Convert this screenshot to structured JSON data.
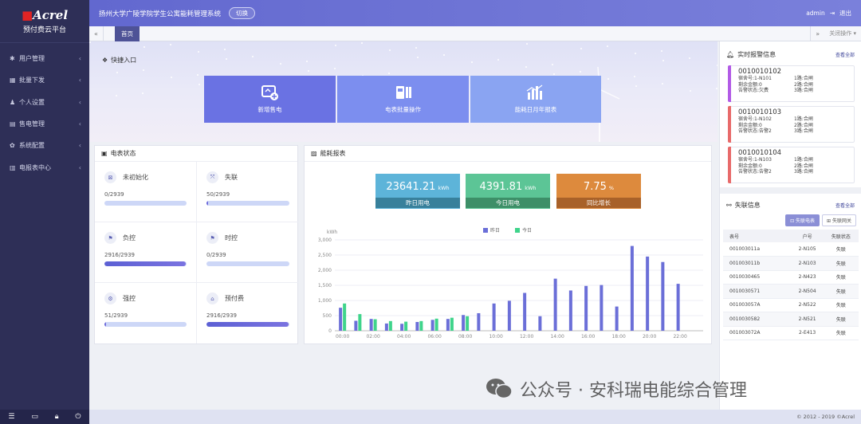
{
  "app": {
    "brand_prefix": "",
    "brand": "Acrel",
    "platform": "预付费云平台",
    "title": "扬州大学广陵学院学生公寓能耗管理系统",
    "switch_label": "切换",
    "user": "admin",
    "logout_label": "退出"
  },
  "menu": [
    {
      "icon": "✱",
      "label": "用户管理"
    },
    {
      "icon": "▦",
      "label": "批量下发"
    },
    {
      "icon": "♟",
      "label": "个人设置"
    },
    {
      "icon": "▤",
      "label": "售电管理"
    },
    {
      "icon": "✿",
      "label": "系统配置"
    },
    {
      "icon": "▥",
      "label": "电报表中心"
    }
  ],
  "tabs": {
    "active": "首页",
    "close_op": "关闭操作"
  },
  "quick": {
    "title": "快捷入口",
    "items": [
      {
        "label": "新增售电"
      },
      {
        "label": "电表批量操作"
      },
      {
        "label": "能耗日月年报表"
      }
    ]
  },
  "meter_status": {
    "title": "电表状态",
    "items": [
      {
        "label": "未初始化",
        "count": "0/2939",
        "fill": 0.0
      },
      {
        "label": "失联",
        "count": "50/2939",
        "fill": 0.017
      },
      {
        "label": "负控",
        "count": "2916/2939",
        "fill": 0.99
      },
      {
        "label": "时控",
        "count": "0/2939",
        "fill": 0.0
      },
      {
        "label": "强控",
        "count": "51/2939",
        "fill": 0.017
      },
      {
        "label": "预付费",
        "count": "2916/2939",
        "fill": 0.99
      }
    ]
  },
  "energy": {
    "title": "能耗报表",
    "yesterday": {
      "value": "23641.21",
      "unit": "kWh",
      "label": "昨日用电"
    },
    "today": {
      "value": "4391.81",
      "unit": "kWh",
      "label": "今日用电"
    },
    "growth": {
      "value": "7.75",
      "unit": "%",
      "label": "同比增长"
    }
  },
  "chart_data": {
    "type": "bar",
    "ylabel": "kWh",
    "ylim": [
      0,
      3000
    ],
    "yticks": [
      "0",
      "500",
      "1,000",
      "1,500",
      "2,000",
      "2,500",
      "3,000"
    ],
    "categories": [
      "00:00",
      "01:00",
      "02:00",
      "03:00",
      "04:00",
      "05:00",
      "06:00",
      "07:00",
      "08:00",
      "09:00",
      "10:00",
      "11:00",
      "12:00",
      "13:00",
      "14:00",
      "15:00",
      "16:00",
      "17:00",
      "18:00",
      "19:00",
      "20:00",
      "21:00",
      "22:00",
      "23:00"
    ],
    "xlabels": [
      "00:00",
      "02:00",
      "04:00",
      "06:00",
      "08:00",
      "10:00",
      "12:00",
      "14:00",
      "16:00",
      "18:00",
      "20:00",
      "22:00"
    ],
    "series": [
      {
        "name": "昨日",
        "color": "#6b6fd8",
        "values": [
          760,
          330,
          390,
          240,
          230,
          290,
          360,
          390,
          520,
          580,
          900,
          990,
          1250,
          480,
          1720,
          1330,
          1480,
          1510,
          800,
          2800,
          2450,
          2270,
          1550,
          0
        ]
      },
      {
        "name": "今日",
        "color": "#3fd48b",
        "values": [
          900,
          550,
          380,
          320,
          300,
          320,
          400,
          430,
          480,
          0,
          0,
          0,
          0,
          0,
          0,
          0,
          0,
          0,
          0,
          0,
          0,
          0,
          0,
          0
        ]
      }
    ]
  },
  "alarms": {
    "title": "实时报警信息",
    "more": "查看全部",
    "items": [
      {
        "id": "0010010102",
        "color": "#b25be6",
        "dorm": "宿舍号:1-N101",
        "amount": "剩余金额:0",
        "state": "告警状态:欠费",
        "r1": "1路:合闸",
        "r2": "2路:合闸",
        "r3": "3路:合闸"
      },
      {
        "id": "0010010103",
        "color": "#e86a6a",
        "dorm": "宿舍号:1-N102",
        "amount": "剩余金额:0",
        "state": "告警状态:告警2",
        "r1": "1路:合闸",
        "r2": "2路:合闸",
        "r3": "3路:合闸"
      },
      {
        "id": "0010010104",
        "color": "#e86a6a",
        "dorm": "宿舍号:1-N103",
        "amount": "剩余金额:0",
        "state": "告警状态:告警2",
        "r1": "1路:合闸",
        "r2": "2路:合闸",
        "r3": "3路:合闸"
      }
    ]
  },
  "lost": {
    "title": "失联信息",
    "more": "查看全部",
    "btn_meter": "失联电表",
    "btn_gateway": "失联网关",
    "headers": [
      "表号",
      "户号",
      "失联状态"
    ],
    "rows": [
      [
        "001003011a",
        "2-N105",
        "失联"
      ],
      [
        "001003011b",
        "2-N103",
        "失联"
      ],
      [
        "0010030465",
        "2-N423",
        "失联"
      ],
      [
        "0010030571",
        "2-N504",
        "失联"
      ],
      [
        "001003057A",
        "2-N522",
        "失联"
      ],
      [
        "0010030582",
        "2-N521",
        "失联"
      ],
      [
        "001003072A",
        "2-E413",
        "失联"
      ]
    ]
  },
  "footer": "© 2012 - 2019 ©Acrel",
  "watermark": "公众号 · 安科瑞电能综合管理"
}
